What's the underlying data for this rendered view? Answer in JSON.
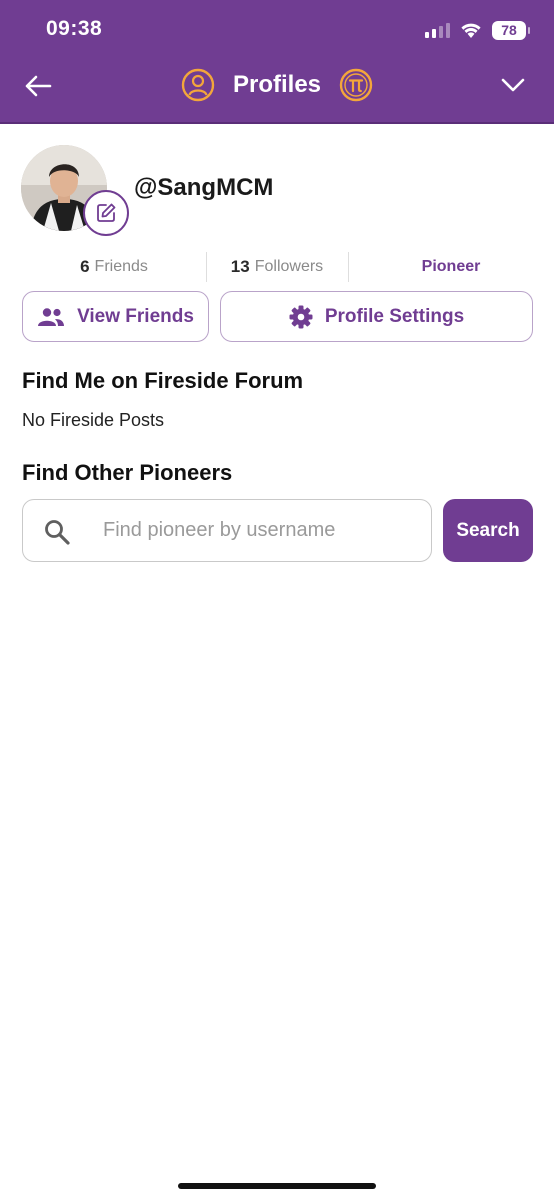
{
  "status_bar": {
    "time": "09:38",
    "battery": "78"
  },
  "nav": {
    "title": "Profiles"
  },
  "profile": {
    "username": "@SangMCM"
  },
  "stats": {
    "friends_count": "6",
    "friends_label": "Friends",
    "followers_count": "13",
    "followers_label": "Followers",
    "role": "Pioneer"
  },
  "buttons": {
    "view_friends": "View Friends",
    "profile_settings": "Profile Settings"
  },
  "fireside": {
    "title": "Find Me on Fireside Forum",
    "empty": "No Fireside Posts"
  },
  "find_pioneers": {
    "title": "Find Other Pioneers",
    "placeholder": "Find pioneer by username",
    "value": "",
    "search_label": "Search"
  },
  "colors": {
    "brand_purple": "#703d92",
    "icon_orange": "#f3a63b"
  },
  "icons": [
    "back-arrow-icon",
    "profile-user-icon",
    "pi-coin-icon",
    "chevron-down-icon",
    "edit-icon",
    "people-icon",
    "gear-icon",
    "search-icon",
    "signal-icon",
    "wifi-icon",
    "battery-icon"
  ]
}
